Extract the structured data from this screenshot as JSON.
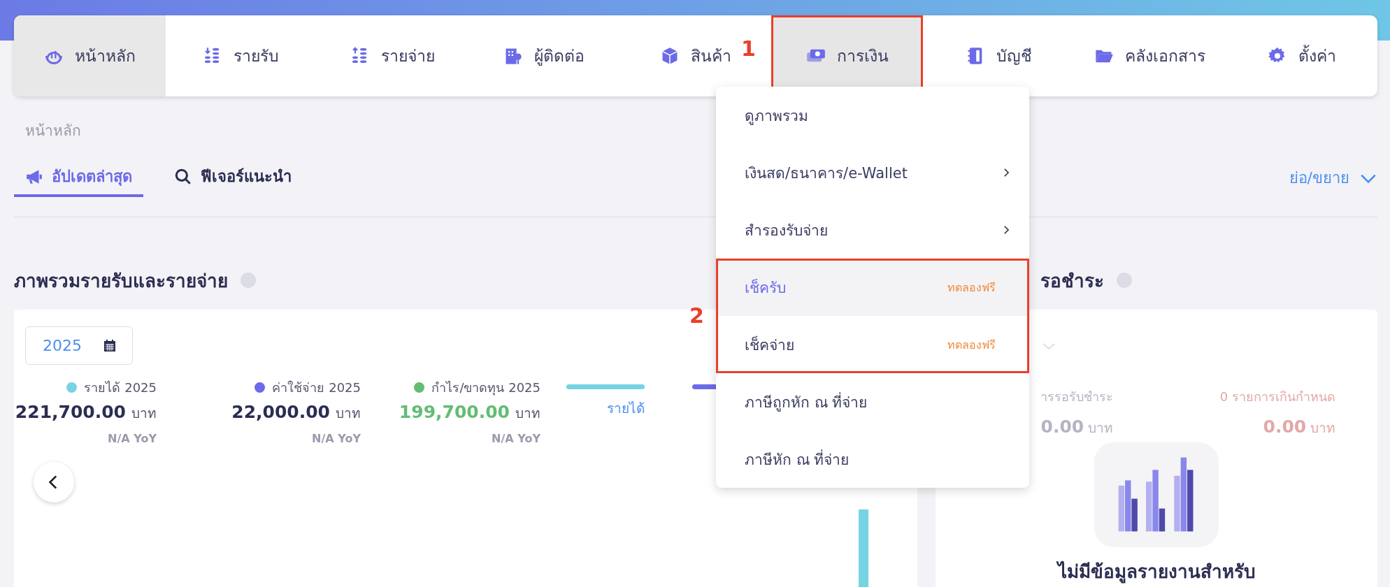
{
  "top_nav": {
    "items": [
      {
        "label": "หน้าหลัก",
        "selected": true,
        "expanded": false,
        "outlined": false
      },
      {
        "label": "รายรับ",
        "selected": false,
        "expanded": false,
        "outlined": false
      },
      {
        "label": "รายจ่าย",
        "selected": false,
        "expanded": false,
        "outlined": false
      },
      {
        "label": "ผู้ติดต่อ",
        "selected": false,
        "expanded": false,
        "outlined": false
      },
      {
        "label": "สินค้า",
        "selected": false,
        "expanded": false,
        "outlined": false
      },
      {
        "label": "การเงิน",
        "selected": false,
        "expanded": true,
        "outlined": true
      },
      {
        "label": "บัญชี",
        "selected": false,
        "expanded": false,
        "outlined": false
      },
      {
        "label": "คลังเอกสาร",
        "selected": false,
        "expanded": false,
        "outlined": false
      },
      {
        "label": "ตั้งค่า",
        "selected": false,
        "expanded": false,
        "outlined": false
      }
    ]
  },
  "breadcrumb": "หน้าหลัก",
  "tabs": [
    {
      "label": "อัปเดตล่าสุด",
      "selected": true
    },
    {
      "label": "ฟีเจอร์แนะนำ",
      "selected": false
    }
  ],
  "collapse_toggle": "ย่อ/ขยาย",
  "finance_menu": {
    "items": [
      {
        "label": "ดูภาพรวม",
        "submenu": false,
        "selected": false,
        "outlined": false
      },
      {
        "label": "เงินสด/ธนาคาร/e-Wallet",
        "submenu": true,
        "selected": false,
        "outlined": false
      },
      {
        "label": "สำรองรับจ่าย",
        "submenu": true,
        "selected": false,
        "outlined": false
      },
      {
        "label": "เช็ครับ",
        "submenu": false,
        "selected": true,
        "badge": "ทดลองฟรี",
        "outlined": true
      },
      {
        "label": "เช็คจ่าย",
        "submenu": false,
        "selected": false,
        "badge": "ทดลองฟรี",
        "outlined": true
      },
      {
        "label": "ภาษีถูกหัก ณ ที่จ่าย",
        "submenu": false,
        "selected": false,
        "outlined": false
      },
      {
        "label": "ภาษีหัก ณ ที่จ่าย",
        "submenu": false,
        "selected": false,
        "outlined": false
      }
    ]
  },
  "annotations": [
    {
      "label": "1"
    },
    {
      "label": "2"
    }
  ],
  "income_expense": {
    "title": "ภาพรวมรายรับและรายจ่าย",
    "year": "2025",
    "stats": [
      {
        "label": "รายได้ 2025",
        "color": "#76d3e4",
        "amount": "221,700.00",
        "unit": "บาท",
        "yoy": "N/A YoY",
        "kind": "neutral"
      },
      {
        "label": "ค่าใช้จ่าย 2025",
        "color": "#6c6ae8",
        "amount": "22,000.00",
        "unit": "บาท",
        "yoy": "N/A YoY",
        "kind": "neutral"
      },
      {
        "label": "กำไร/ขาดทุน 2025",
        "color": "#62bd74",
        "amount": "199,700.00",
        "unit": "บาท",
        "yoy": "N/A YoY",
        "kind": "positive"
      }
    ],
    "legend": [
      {
        "label": "รายได้",
        "color": "#76d3e4"
      },
      {
        "color": "#6c6ae8"
      }
    ]
  },
  "payments": {
    "title": "รอชำระ",
    "stats": [
      {
        "label": "ารรอรับชำระ",
        "amount": "0.00",
        "unit": "บาท"
      },
      {
        "label": "0 รายการเกินกำหนด",
        "amount": "0.00",
        "unit": "บาท"
      }
    ],
    "empty_message": "ไม่มีข้อมูลรายงานสำหรับ"
  }
}
